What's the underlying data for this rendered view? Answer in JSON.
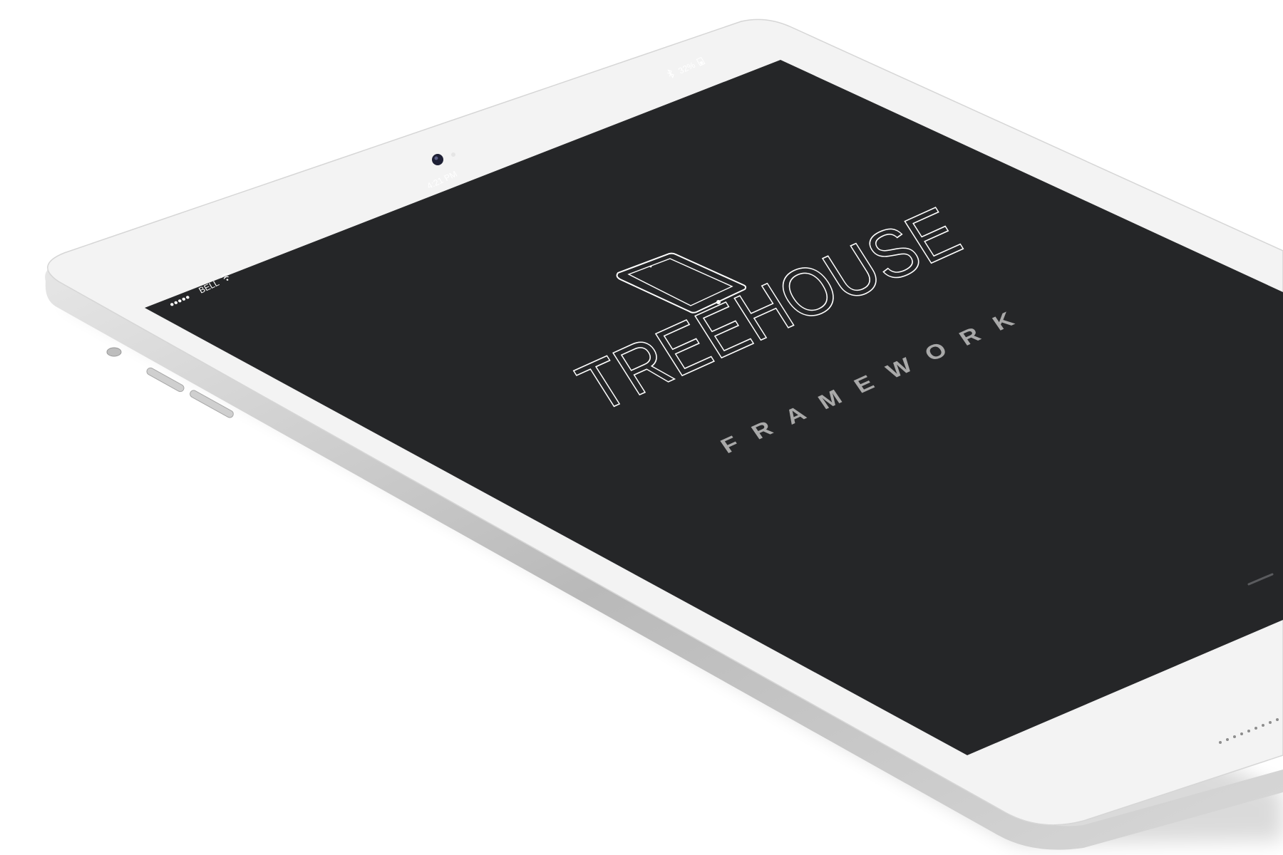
{
  "status_bar": {
    "signal_dots": "●●●●●",
    "carrier": "BELL",
    "time": "4:21 PM",
    "battery": "32%"
  },
  "hero": {
    "title": "TREEHOUSE",
    "subtitle": "FRAMEWORK"
  },
  "icons": {
    "wifi": "wifi-icon",
    "bluetooth": "bluetooth-icon",
    "battery": "battery-icon",
    "device": "tablet-outline-icon",
    "camera": "front-camera-icon"
  },
  "colors": {
    "screen": "#252628",
    "bezel": "#f3f3f3",
    "frame": "#c9c9c9",
    "title": "#ffffff",
    "subtitle": "#a9a9a9"
  }
}
